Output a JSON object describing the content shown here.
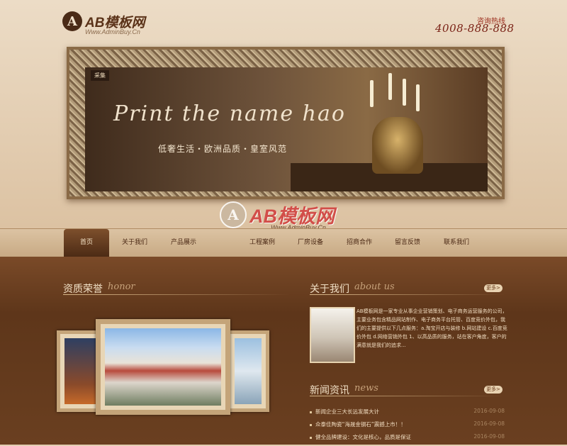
{
  "header": {
    "logo_mark": "A",
    "logo_text": "AB模板网",
    "logo_sub": "Www.AdminBuy.Cn",
    "hotline_label": "咨询热线",
    "hotline_number": "4008-888-888"
  },
  "banner": {
    "tag": "采集",
    "script_text": "Print the name hao",
    "slogan": "低奢生活・欧洲品质・皇室风范"
  },
  "watermark": {
    "mark": "A",
    "text": "AB模板网",
    "sub": "Www.AdminBuy.Cn"
  },
  "nav": {
    "items": [
      "首页",
      "关于我们",
      "产品展示",
      "工程案例",
      "厂房设备",
      "招商合作",
      "留言反馈",
      "联系我们"
    ],
    "active_index": 0
  },
  "honor": {
    "title": "资质荣誉",
    "deco": "honor"
  },
  "about": {
    "title": "关于我们",
    "deco": "about us",
    "more": "更多>",
    "text": "AB模板网是一家专业从事企业营销策划、电子商务运营服务的公司，主要业务包含精品网站制作、电子商务平台托管、百度竞价外包，我们的主要提供以下几点服务：a.淘宝开店与装修 b.网站建设 c.百度竞价外包 d.网络营销外包 1、以高品质的服务，站在客户角度，客户的满意就是我们的追求..."
  },
  "news": {
    "title": "新闻资讯",
    "deco": "news",
    "more": "更多>",
    "items": [
      {
        "title": "新闻企业三大长远发展大计",
        "date": "2016-09-08"
      },
      {
        "title": "众泰佳陶瓷“海晟金钢石”震撼上市！！",
        "date": "2016-09-08"
      },
      {
        "title": "健全品牌建设：文化是核心，品质是保证",
        "date": "2016-09-08"
      }
    ]
  }
}
